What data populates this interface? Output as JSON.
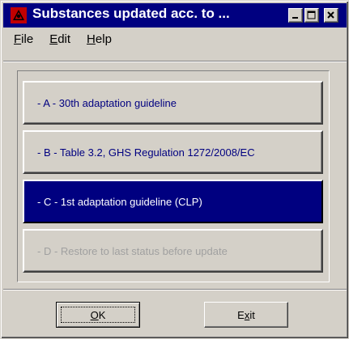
{
  "window": {
    "title": "Substances updated acc. to ...",
    "app_icon": "red-warning-icon"
  },
  "titlebar_buttons": {
    "minimize": "minimize-icon",
    "maximize": "maximize-icon",
    "close": "close-icon"
  },
  "menu": {
    "file": {
      "access_key": "F",
      "rest": "ile"
    },
    "edit": {
      "access_key": "E",
      "rest": "dit"
    },
    "help": {
      "access_key": "H",
      "rest": "elp"
    }
  },
  "options": [
    {
      "label": "- A -  30th adaptation guideline",
      "state": "normal"
    },
    {
      "label": "- B -  Table 3.2, GHS Regulation 1272/2008/EC",
      "state": "normal"
    },
    {
      "label": "- C -  1st adaptation guideline (CLP)",
      "state": "selected"
    },
    {
      "label": "- D -  Restore to last status before update",
      "state": "disabled"
    }
  ],
  "buttons": {
    "ok": {
      "access_key": "O",
      "rest": "K"
    },
    "exit": {
      "pre": "E",
      "access_key": "x",
      "rest": "it"
    }
  },
  "colors": {
    "titlebar": "#000080",
    "selected": "#000080",
    "option_text": "#000080",
    "disabled_text": "#a0a0a0",
    "face": "#d4d0c8"
  }
}
